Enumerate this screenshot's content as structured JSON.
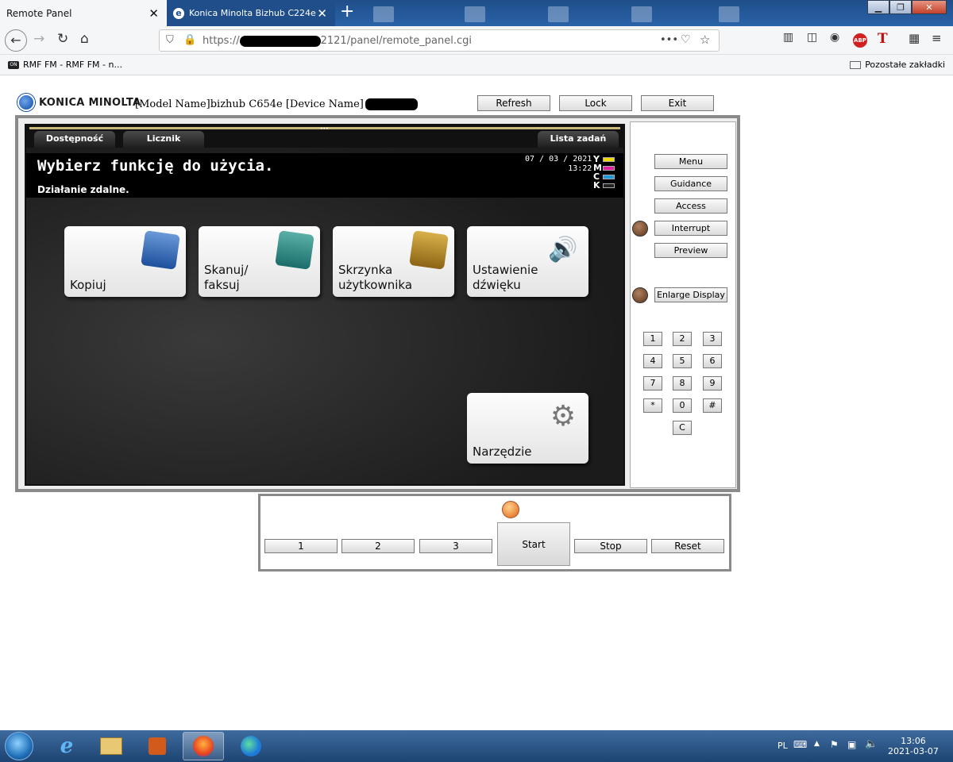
{
  "browser": {
    "tabs": [
      {
        "label": "Remote Panel"
      },
      {
        "label": "Konica Minolta Bizhub C224e -"
      }
    ],
    "url_prefix": "https://",
    "url_suffix": "2121/panel/remote_panel.cgi",
    "bookmarks": [
      {
        "label": "RMF FM - RMF FM - n..."
      }
    ],
    "other_bookmarks": "Pozostałe zakładki"
  },
  "panel_header": {
    "brand": "KONICA MINOLTA",
    "model_text": "[Model Name]bizhub C654e [Device Name]",
    "buttons": {
      "refresh": "Refresh",
      "lock": "Lock",
      "exit": "Exit"
    }
  },
  "screen": {
    "tabs": {
      "left1": "Dostępność",
      "left2": "Licznik",
      "right": "Lista zadań"
    },
    "title": "Wybierz funkcję do użycia.",
    "subtitle": "Działanie zdalne.",
    "date": "07 / 03 / 2021",
    "time": "13:22",
    "toner": [
      {
        "label": "Y",
        "color": "#f0d800"
      },
      {
        "label": "M",
        "color": "#e0209c"
      },
      {
        "label": "C",
        "color": "#1e9ad8"
      },
      {
        "label": "K",
        "color": "#222222"
      }
    ],
    "functions": {
      "copy": {
        "line1": "Kopiuj",
        "line2": ""
      },
      "scan": {
        "line1": "Skanuj/",
        "line2": "faksuj"
      },
      "box": {
        "line1": "Skrzynka",
        "line2": "użytkownika"
      },
      "sound": {
        "line1": "Ustawienie",
        "line2": "dźwięku"
      },
      "utility": {
        "line1": "Narzędzie",
        "line2": ""
      }
    }
  },
  "side_panel": {
    "menu": "Menu",
    "guidance": "Guidance",
    "access": "Access",
    "interrupt": "Interrupt",
    "preview": "Preview",
    "enlarge": "Enlarge Display",
    "keypad": [
      "1",
      "2",
      "3",
      "4",
      "5",
      "6",
      "7",
      "8",
      "9",
      "*",
      "0",
      "#",
      "C"
    ]
  },
  "bottom_panel": {
    "b1": "1",
    "b2": "2",
    "b3": "3",
    "start": "Start",
    "stop": "Stop",
    "reset": "Reset"
  },
  "taskbar": {
    "lang": "PL",
    "time": "13:06",
    "date": "2021-03-07"
  }
}
